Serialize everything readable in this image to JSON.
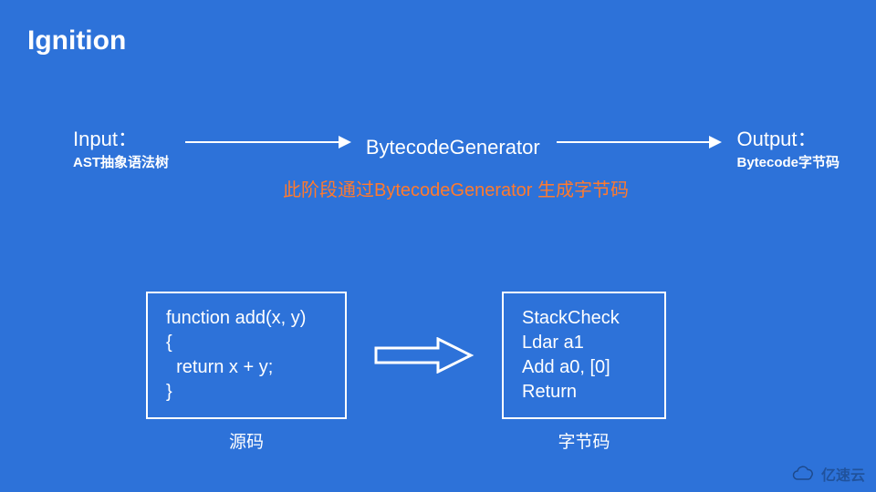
{
  "title": "Ignition",
  "flow": {
    "input": {
      "title": "Input：",
      "sub": "AST抽象语法树"
    },
    "center": "BytecodeGenerator",
    "output": {
      "title": "Output：",
      "sub": "Bytecode字节码"
    }
  },
  "annotation": "此阶段通过BytecodeGenerator\n生成字节码",
  "example": {
    "source": "function add(x, y)\n{\n  return x + y;\n}",
    "bytecode": "StackCheck\nLdar a1\nAdd a0, [0]\nReturn",
    "source_caption": "源码",
    "bytecode_caption": "字节码"
  },
  "watermark": "亿速云",
  "colors": {
    "background": "#2d72d9",
    "text": "#ffffff",
    "annotation": "#ff7a2e"
  }
}
